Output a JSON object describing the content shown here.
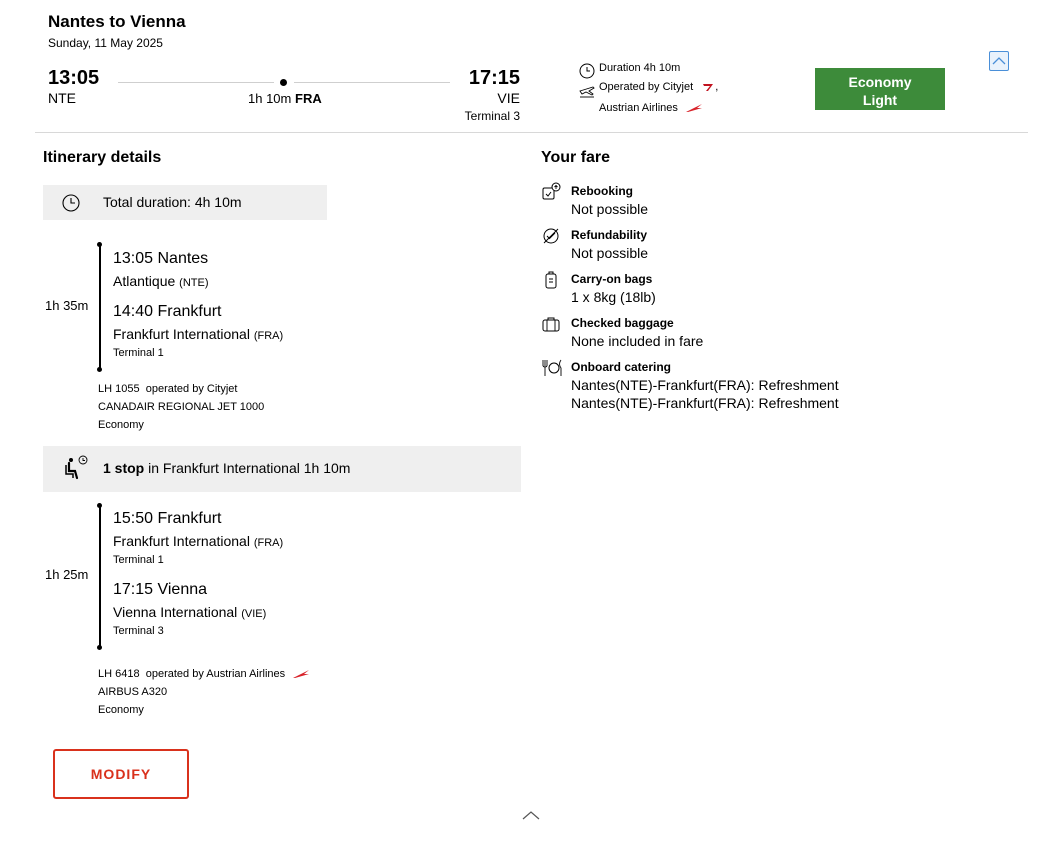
{
  "header": {
    "title": "Nantes to Vienna",
    "date": "Sunday, 11 May 2025",
    "departure_time": "13:05",
    "departure_code": "NTE",
    "stop_duration": "1h 10m",
    "stop_code": "FRA",
    "arrival_time": "17:15",
    "arrival_code": "VIE",
    "arrival_terminal": "Terminal 3"
  },
  "summary": {
    "duration": "Duration 4h 10m",
    "operated_by": "Operated by Cityjet",
    "separator": ",",
    "second_operator": "Austrian Airlines"
  },
  "fare_button": {
    "line1": "Economy",
    "line2": "Light",
    "color": "#3d8b3a"
  },
  "itinerary": {
    "heading": "Itinerary details",
    "total_duration": "Total duration: 4h 10m",
    "segments": [
      {
        "duration": "1h 35m",
        "dep_time_city": "13:05 Nantes",
        "dep_airport": "Atlantique",
        "dep_code": "(NTE)",
        "arr_time_city": "14:40 Frankfurt",
        "arr_airport": "Frankfurt International",
        "arr_code": "(FRA)",
        "arr_terminal": "Terminal 1",
        "flight": "LH 1055",
        "operated": "operated by Cityjet",
        "aircraft": "CANADAIR REGIONAL JET 1000",
        "cabin": "Economy"
      },
      {
        "duration": "1h 25m",
        "dep_time_city": "15:50 Frankfurt",
        "dep_airport": "Frankfurt International",
        "dep_code": "(FRA)",
        "dep_terminal": "Terminal 1",
        "arr_time_city": "17:15 Vienna",
        "arr_airport": "Vienna International",
        "arr_code": "(VIE)",
        "arr_terminal": "Terminal 3",
        "flight": "LH 6418",
        "operated": "operated by Austrian Airlines",
        "aircraft": "AIRBUS A320",
        "cabin": "Economy"
      }
    ],
    "layover": {
      "stop_count": "1 stop",
      "text": "in Frankfurt International 1h 10m"
    },
    "modify_label": "MODIFY",
    "accent_color": "#d9311c"
  },
  "fare": {
    "heading": "Your fare",
    "items": [
      {
        "icon": "rebooking-icon",
        "label": "Rebooking",
        "value": "Not possible"
      },
      {
        "icon": "refundability-icon",
        "label": "Refundability",
        "value": "Not possible"
      },
      {
        "icon": "carry-on-bag-icon",
        "label": "Carry-on bags",
        "value": "1 x 8kg (18lb)"
      },
      {
        "icon": "checked-baggage-icon",
        "label": "Checked baggage",
        "value": "None included in fare"
      },
      {
        "icon": "catering-icon",
        "label": "Onboard catering",
        "value": "Nantes(NTE)-Frankfurt(FRA): Refreshment",
        "value2": "Nantes(NTE)-Frankfurt(FRA): Refreshment"
      }
    ]
  }
}
